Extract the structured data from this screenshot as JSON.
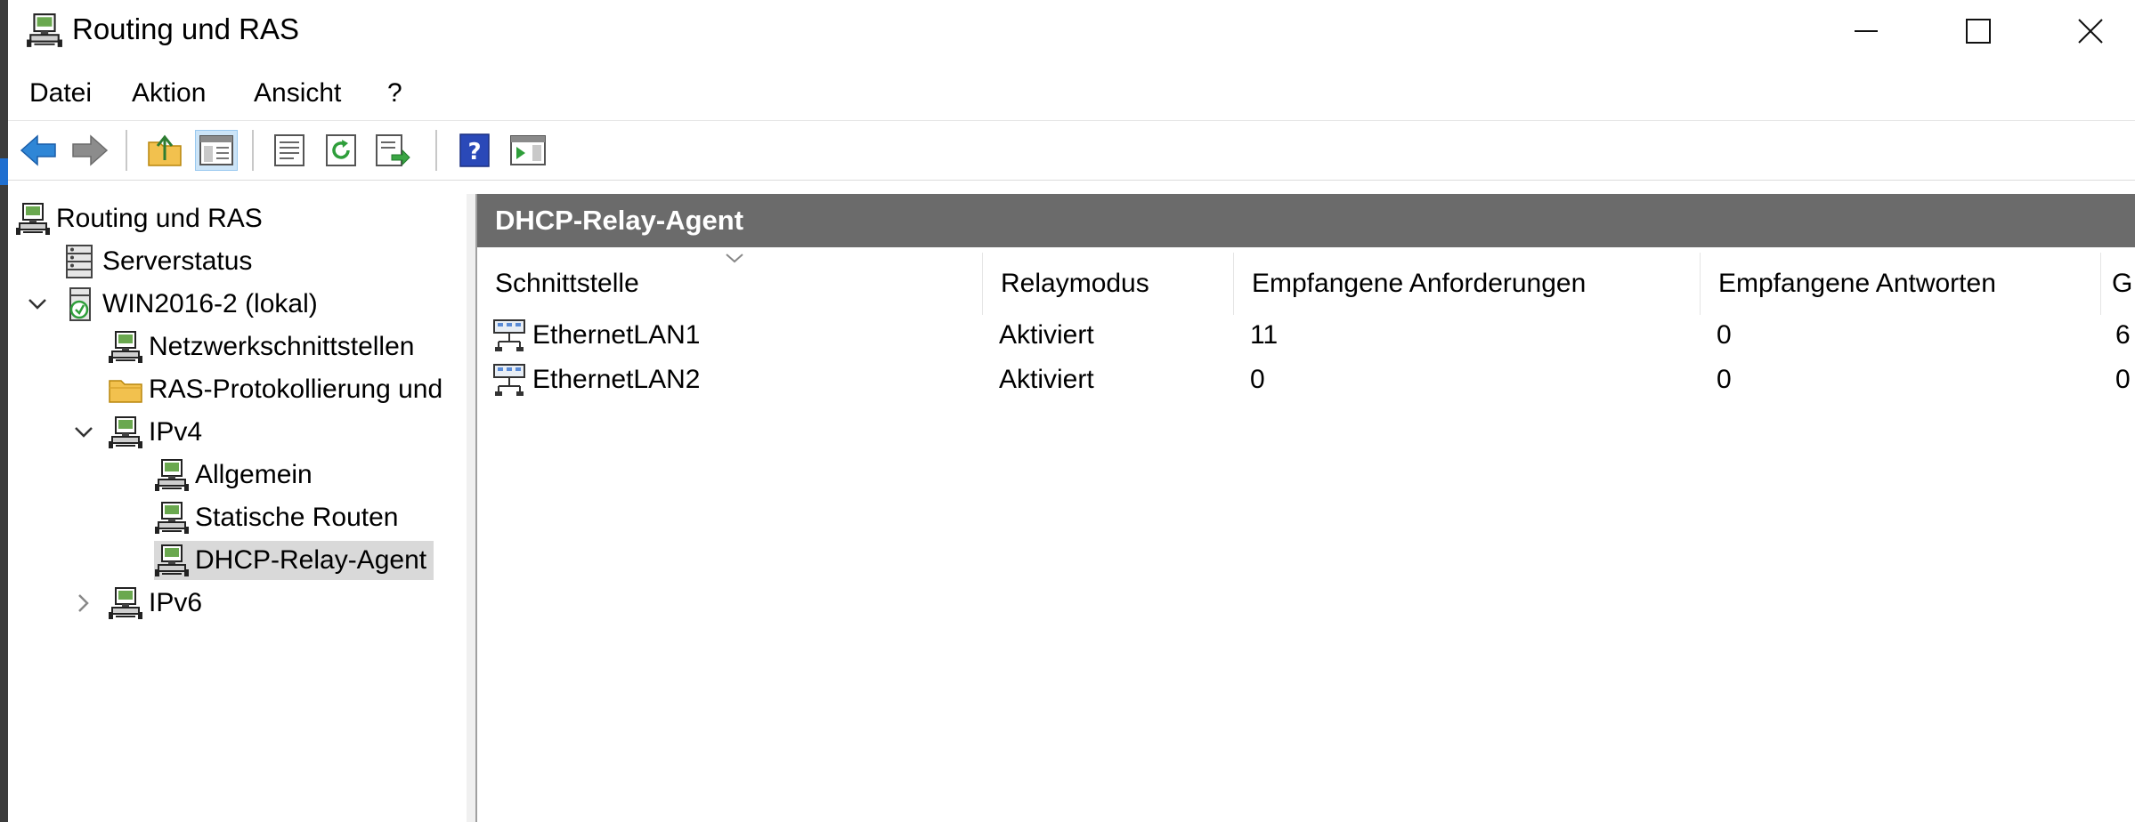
{
  "window": {
    "title": "Routing und RAS",
    "icon": "routing-ras-icon",
    "controls": [
      "minimize-icon",
      "maximize-icon",
      "close-icon"
    ]
  },
  "menu": {
    "items": [
      "Datei",
      "Aktion",
      "Ansicht",
      "?"
    ]
  },
  "toolbar": {
    "buttons": [
      "back-arrow-icon",
      "forward-arrow-icon",
      "up-folder-icon",
      "show-hide-tree-icon",
      "properties-icon",
      "refresh-icon",
      "export-list-icon",
      "help-icon",
      "show-action-pane-icon"
    ]
  },
  "tree": {
    "items": [
      {
        "label": "Routing und RAS"
      },
      {
        "label": "Serverstatus"
      },
      {
        "label": "WIN2016-2 (lokal)"
      },
      {
        "label": "Netzwerkschnittstellen"
      },
      {
        "label": "RAS-Protokollierung und"
      },
      {
        "label": "IPv4"
      },
      {
        "label": "Allgemein"
      },
      {
        "label": "Statische Routen"
      },
      {
        "label": "DHCP-Relay-Agent"
      },
      {
        "label": "IPv6"
      }
    ],
    "selected": "DHCP-Relay-Agent"
  },
  "results": {
    "header": "DHCP-Relay-Agent",
    "columns": [
      "Schnittstelle",
      "Relaymodus",
      "Empfangene Anforderungen",
      "Empfangene Antworten",
      "G"
    ],
    "rows": [
      [
        "EthernetLAN1",
        "Aktiviert",
        "11",
        "0",
        "6"
      ],
      [
        "EthernetLAN2",
        "Aktiviert",
        "0",
        "0",
        "0"
      ]
    ]
  },
  "colors": {
    "results_header_bg": "#6b6b6b",
    "selection_bg": "#d9d9d9",
    "pressed_button_bg": "#cce4f7"
  }
}
